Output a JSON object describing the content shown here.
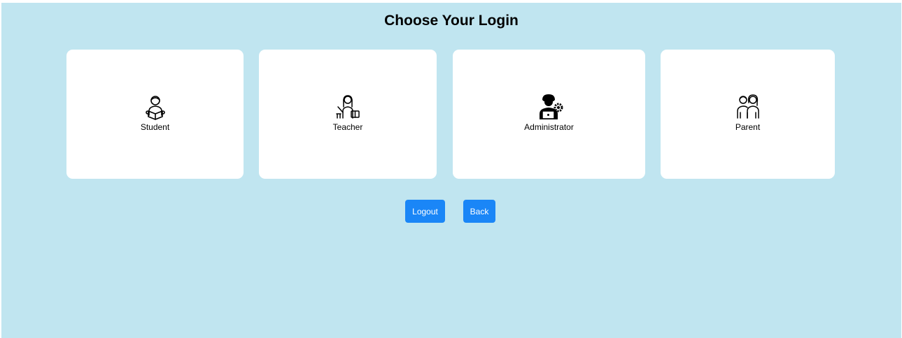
{
  "header": {
    "title": "Choose Your Login"
  },
  "cards": [
    {
      "label": "Student",
      "icon": "student-reading-icon"
    },
    {
      "label": "Teacher",
      "icon": "teacher-icon"
    },
    {
      "label": "Administrator",
      "icon": "administrator-laptop-gear-icon"
    },
    {
      "label": "Parent",
      "icon": "parents-couple-icon"
    }
  ],
  "actions": {
    "logout_label": "Logout",
    "back_label": "Back"
  },
  "colors": {
    "background": "#c0e5f0",
    "card": "#ffffff",
    "button": "#1a86f7",
    "button_text": "#ffffff"
  }
}
